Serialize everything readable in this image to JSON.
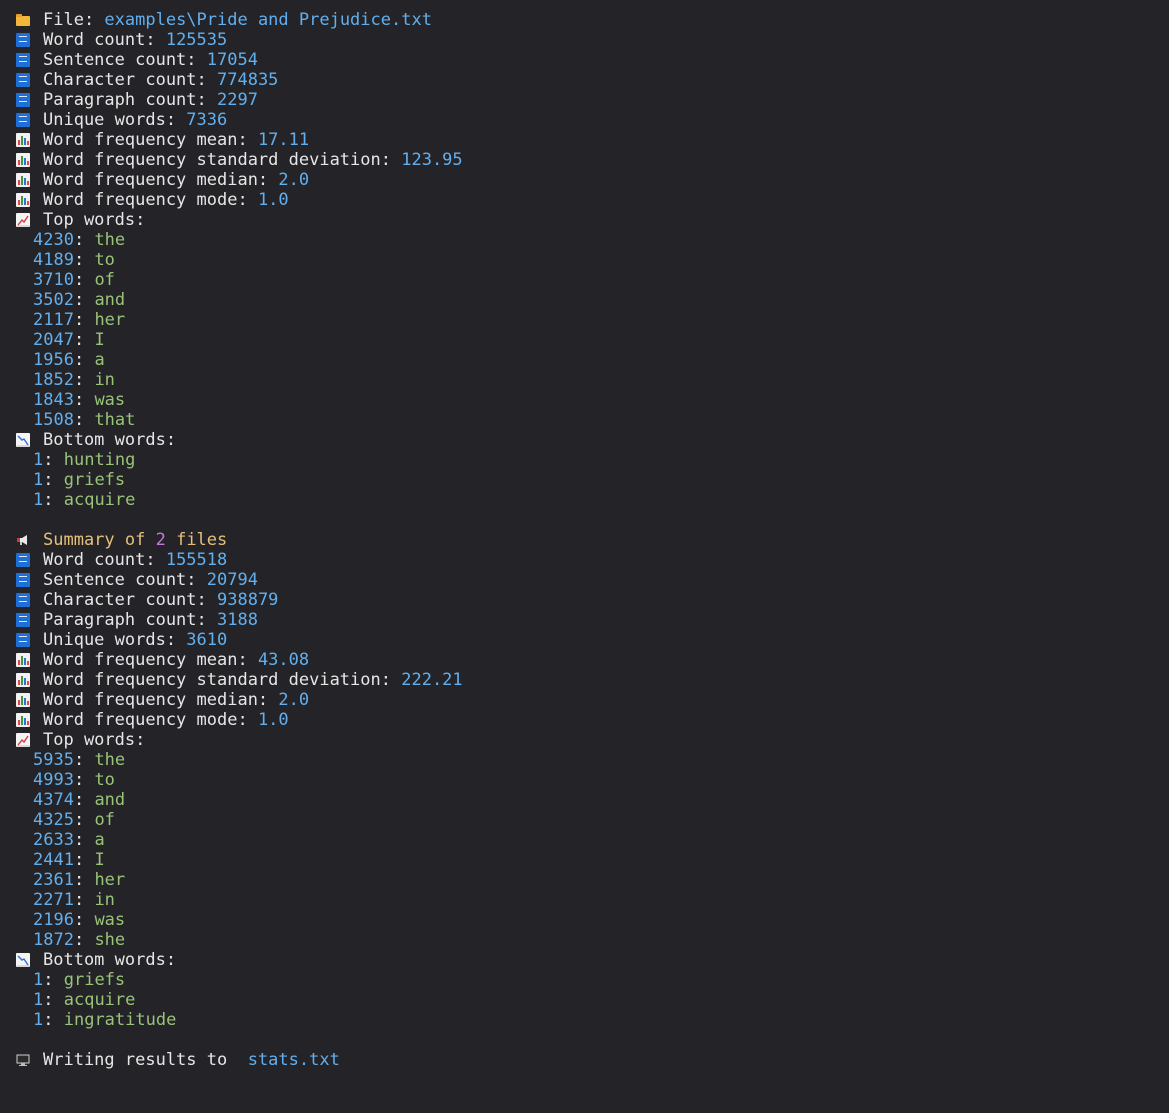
{
  "file_report": {
    "file_label": "File: ",
    "file_path": "examples\\Pride and Prejudice.txt",
    "stats": [
      {
        "icon": "numbers-icon",
        "label": "Word count: ",
        "value": "125535"
      },
      {
        "icon": "numbers-icon",
        "label": "Sentence count: ",
        "value": "17054"
      },
      {
        "icon": "numbers-icon",
        "label": "Character count: ",
        "value": "774835"
      },
      {
        "icon": "numbers-icon",
        "label": "Paragraph count: ",
        "value": "2297"
      },
      {
        "icon": "numbers-icon",
        "label": "Unique words: ",
        "value": "7336"
      },
      {
        "icon": "bar-chart-icon",
        "label": "Word frequency mean: ",
        "value": "17.11"
      },
      {
        "icon": "bar-chart-icon",
        "label": "Word frequency standard deviation: ",
        "value": "123.95"
      },
      {
        "icon": "bar-chart-icon",
        "label": "Word frequency median: ",
        "value": "2.0"
      },
      {
        "icon": "bar-chart-icon",
        "label": "Word frequency mode: ",
        "value": "1.0"
      }
    ],
    "top_words_label": "Top words:",
    "top_words": [
      {
        "count": "4230",
        "word": "the"
      },
      {
        "count": "4189",
        "word": "to"
      },
      {
        "count": "3710",
        "word": "of"
      },
      {
        "count": "3502",
        "word": "and"
      },
      {
        "count": "2117",
        "word": "her"
      },
      {
        "count": "2047",
        "word": "I"
      },
      {
        "count": "1956",
        "word": "a"
      },
      {
        "count": "1852",
        "word": "in"
      },
      {
        "count": "1843",
        "word": "was"
      },
      {
        "count": "1508",
        "word": "that"
      }
    ],
    "bottom_words_label": "Bottom words:",
    "bottom_words": [
      {
        "count": "1",
        "word": "hunting"
      },
      {
        "count": "1",
        "word": "griefs"
      },
      {
        "count": "1",
        "word": "acquire"
      }
    ]
  },
  "summary": {
    "prefix": "Summary of ",
    "count": "2",
    "suffix": " files",
    "stats": [
      {
        "icon": "numbers-icon",
        "label": "Word count: ",
        "value": "155518"
      },
      {
        "icon": "numbers-icon",
        "label": "Sentence count: ",
        "value": "20794"
      },
      {
        "icon": "numbers-icon",
        "label": "Character count: ",
        "value": "938879"
      },
      {
        "icon": "numbers-icon",
        "label": "Paragraph count: ",
        "value": "3188"
      },
      {
        "icon": "numbers-icon",
        "label": "Unique words: ",
        "value": "3610"
      },
      {
        "icon": "bar-chart-icon",
        "label": "Word frequency mean: ",
        "value": "43.08"
      },
      {
        "icon": "bar-chart-icon",
        "label": "Word frequency standard deviation: ",
        "value": "222.21"
      },
      {
        "icon": "bar-chart-icon",
        "label": "Word frequency median: ",
        "value": "2.0"
      },
      {
        "icon": "bar-chart-icon",
        "label": "Word frequency mode: ",
        "value": "1.0"
      }
    ],
    "top_words_label": "Top words:",
    "top_words": [
      {
        "count": "5935",
        "word": "the"
      },
      {
        "count": "4993",
        "word": "to"
      },
      {
        "count": "4374",
        "word": "and"
      },
      {
        "count": "4325",
        "word": "of"
      },
      {
        "count": "2633",
        "word": "a"
      },
      {
        "count": "2441",
        "word": "I"
      },
      {
        "count": "2361",
        "word": "her"
      },
      {
        "count": "2271",
        "word": "in"
      },
      {
        "count": "2196",
        "word": "was"
      },
      {
        "count": "1872",
        "word": "she"
      }
    ],
    "bottom_words_label": "Bottom words:",
    "bottom_words": [
      {
        "count": "1",
        "word": "griefs"
      },
      {
        "count": "1",
        "word": "acquire"
      },
      {
        "count": "1",
        "word": "ingratitude"
      }
    ]
  },
  "footer": {
    "label": "Writing results to  ",
    "target": "stats.txt"
  },
  "colors": {
    "background": "#242428",
    "text": "#e6e6e6",
    "number": "#61afef",
    "word": "#98c379",
    "summary_title": "#e5c07b",
    "summary_count": "#c678dd"
  }
}
